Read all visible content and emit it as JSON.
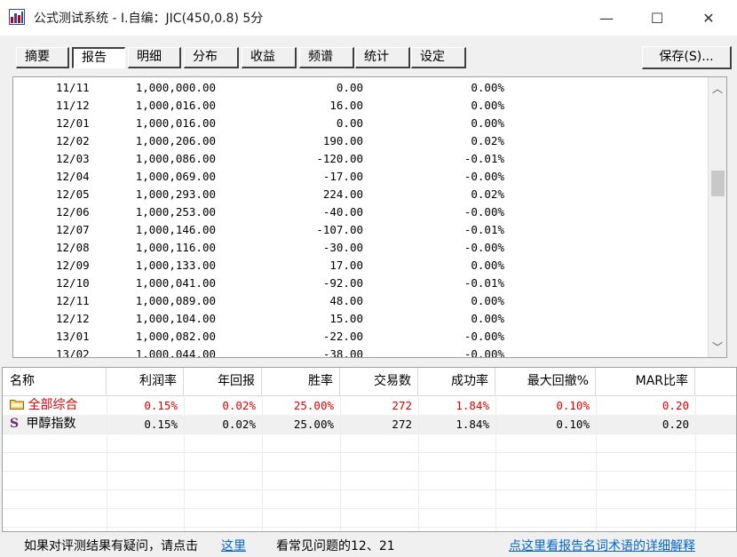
{
  "window": {
    "title": "公式测试系统 - I.自编：JIC(450,0.8) 5分",
    "minimize": "—",
    "maximize": "☐",
    "close": "✕"
  },
  "tabs": [
    {
      "label": "摘要",
      "active": false
    },
    {
      "label": "报告",
      "active": true
    },
    {
      "label": "明细",
      "active": false
    },
    {
      "label": "分布",
      "active": false
    },
    {
      "label": "收益",
      "active": false
    },
    {
      "label": "频谱",
      "active": false
    },
    {
      "label": "统计",
      "active": false
    },
    {
      "label": "设定",
      "active": false
    }
  ],
  "save_button": "保存(S)...",
  "report_rows": [
    {
      "date": "11/11",
      "balance": "1,000,000.00",
      "pl": "0.00",
      "pct": "0.00%"
    },
    {
      "date": "11/12",
      "balance": "1,000,016.00",
      "pl": "16.00",
      "pct": "0.00%"
    },
    {
      "date": "12/01",
      "balance": "1,000,016.00",
      "pl": "0.00",
      "pct": "0.00%"
    },
    {
      "date": "12/02",
      "balance": "1,000,206.00",
      "pl": "190.00",
      "pct": "0.02%"
    },
    {
      "date": "12/03",
      "balance": "1,000,086.00",
      "pl": "-120.00",
      "pct": "-0.01%"
    },
    {
      "date": "12/04",
      "balance": "1,000,069.00",
      "pl": "-17.00",
      "pct": "-0.00%"
    },
    {
      "date": "12/05",
      "balance": "1,000,293.00",
      "pl": "224.00",
      "pct": "0.02%"
    },
    {
      "date": "12/06",
      "balance": "1,000,253.00",
      "pl": "-40.00",
      "pct": "-0.00%"
    },
    {
      "date": "12/07",
      "balance": "1,000,146.00",
      "pl": "-107.00",
      "pct": "-0.01%"
    },
    {
      "date": "12/08",
      "balance": "1,000,116.00",
      "pl": "-30.00",
      "pct": "-0.00%"
    },
    {
      "date": "12/09",
      "balance": "1,000,133.00",
      "pl": "17.00",
      "pct": "0.00%"
    },
    {
      "date": "12/10",
      "balance": "1,000,041.00",
      "pl": "-92.00",
      "pct": "-0.01%"
    },
    {
      "date": "12/11",
      "balance": "1,000,089.00",
      "pl": "48.00",
      "pct": "0.00%"
    },
    {
      "date": "12/12",
      "balance": "1,000,104.00",
      "pl": "15.00",
      "pct": "0.00%"
    },
    {
      "date": "13/01",
      "balance": "1,000,082.00",
      "pl": "-22.00",
      "pct": "-0.00%"
    },
    {
      "date": "13/02",
      "balance": "1,000,044.00",
      "pl": "-38.00",
      "pct": "-0.00%"
    }
  ],
  "summary": {
    "headers": [
      "名称",
      "利润率",
      "年回报",
      "胜率",
      "交易数",
      "成功率",
      "最大回撤%",
      "MAR比率"
    ],
    "rows": [
      {
        "name": "全部综合",
        "icon": "folder-icon",
        "values": [
          "0.15%",
          "0.02%",
          "25.00%",
          "272",
          "1.84%",
          "0.10%",
          "0.20"
        ],
        "highlight": true
      },
      {
        "name": "甲醇指数",
        "icon": "s-icon",
        "values": [
          "0.15%",
          "0.02%",
          "25.00%",
          "272",
          "1.84%",
          "0.10%",
          "0.20"
        ],
        "highlight": false
      }
    ]
  },
  "footer": {
    "question_text": "如果对评测结果有疑问，请点击",
    "here_link": "这里",
    "faq_text": "看常见问题的12、21",
    "glossary_link": "点这里看报告名词术语的详细解释"
  },
  "colors": {
    "accent_red": "#e00000",
    "link_blue": "#0066cc"
  }
}
